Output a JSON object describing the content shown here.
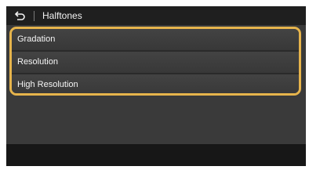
{
  "header": {
    "title": "Halftones",
    "back_icon": "back-arrow-icon"
  },
  "menu": {
    "items": [
      {
        "label": "Gradation"
      },
      {
        "label": "Resolution"
      },
      {
        "label": "High Resolution"
      }
    ]
  },
  "colors": {
    "panel_background": "#3a3a3a",
    "header_background": "#1f1f1f",
    "focus_border": "#e6b44c",
    "text": "#f5f5f5",
    "footer_background": "#171717"
  }
}
